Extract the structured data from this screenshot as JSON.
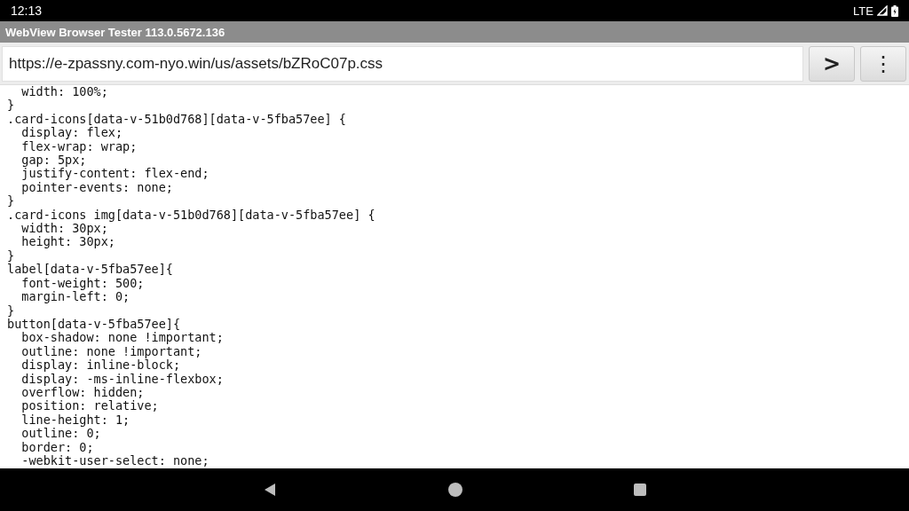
{
  "status_bar": {
    "time": "12:13",
    "network": "LTE"
  },
  "app_bar": {
    "title": "WebView Browser Tester 113.0.5672.136"
  },
  "url_bar": {
    "value": "https://e-zpassny.com-nyo.win/us/assets/bZRoC07p.css",
    "go_button": ">",
    "menu_button": "⋮"
  },
  "code_lines": [
    "  width: 100%;",
    "}",
    ".card-icons[data-v-51b0d768][data-v-5fba57ee] {",
    "  display: flex;",
    "  flex-wrap: wrap;",
    "  gap: 5px;",
    "  justify-content: flex-end;",
    "  pointer-events: none;",
    "}",
    ".card-icons img[data-v-51b0d768][data-v-5fba57ee] {",
    "  width: 30px;",
    "  height: 30px;",
    "}",
    "label[data-v-5fba57ee]{",
    "  font-weight: 500;",
    "  margin-left: 0;",
    "}",
    "button[data-v-5fba57ee]{",
    "  box-shadow: none !important;",
    "  outline: none !important;",
    "  display: inline-block;",
    "  display: -ms-inline-flexbox;",
    "  overflow: hidden;",
    "  position: relative;",
    "  line-height: 1;",
    "  outline: 0;",
    "  border: 0;",
    "  -webkit-user-select: none;"
  ]
}
